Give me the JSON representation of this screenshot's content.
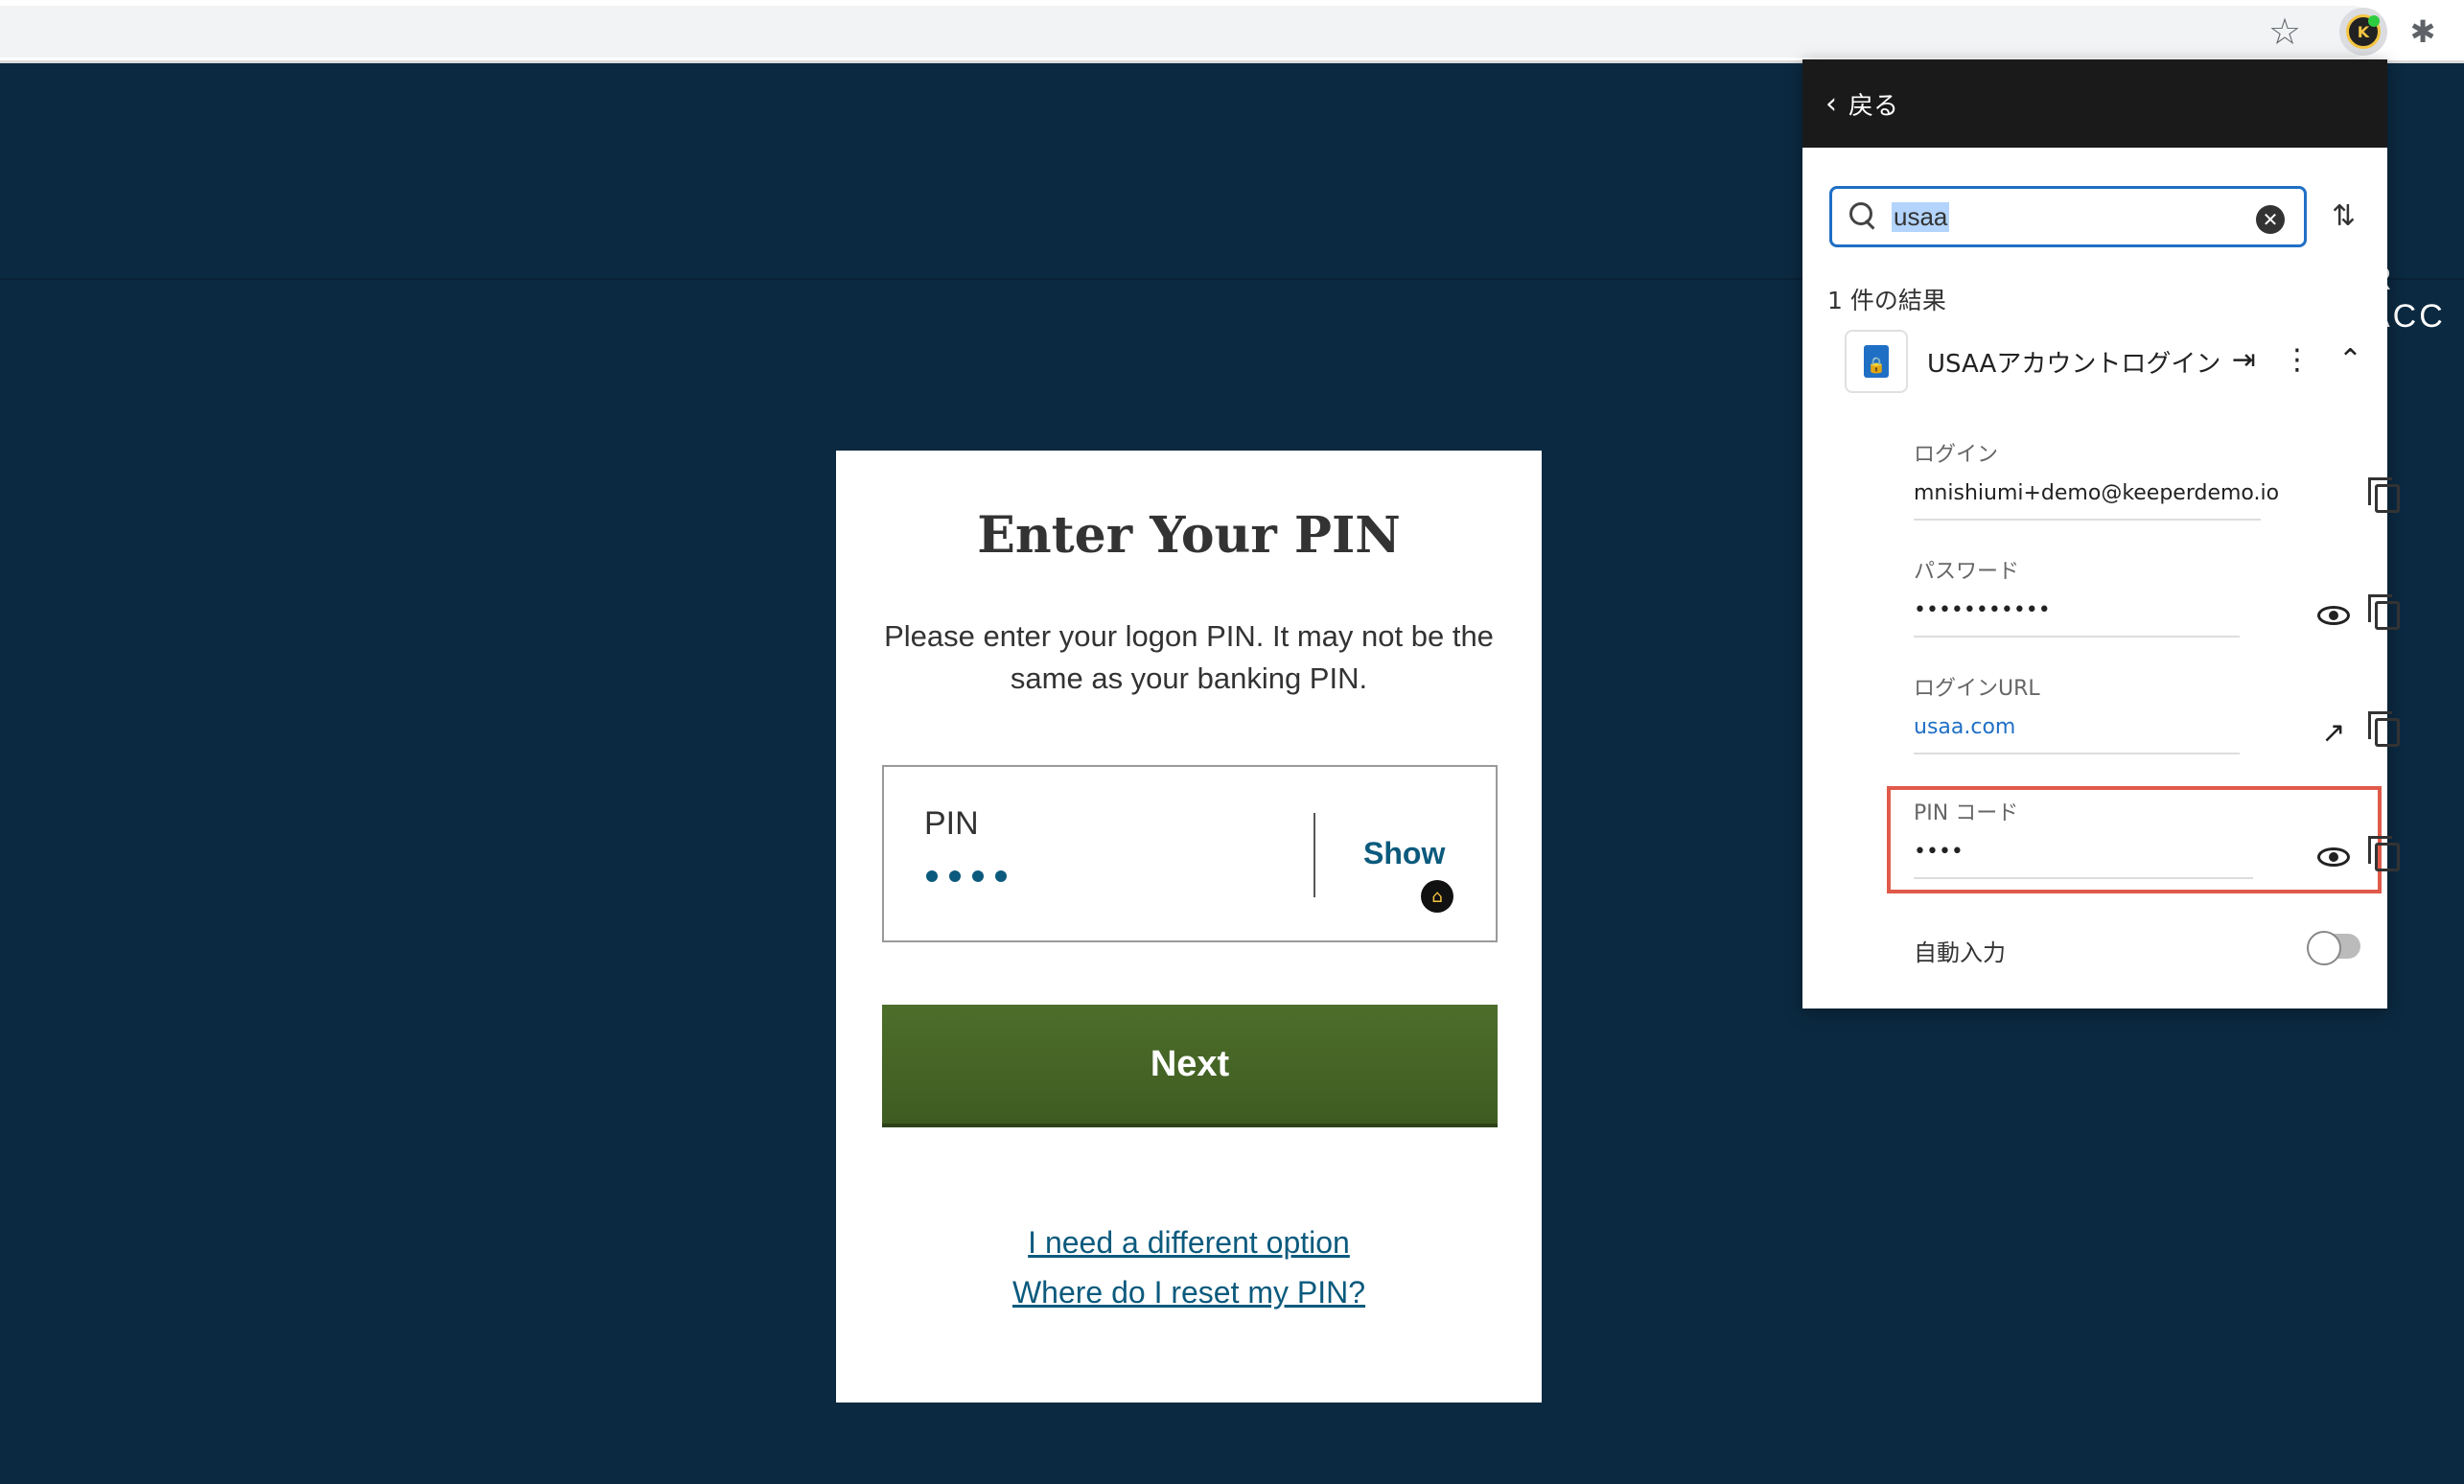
{
  "browser": {
    "extension_names": [
      "star-icon",
      "keeper-extension-icon",
      "puzzle-icon"
    ]
  },
  "page": {
    "nav_text": "R ACC",
    "card": {
      "title": "Enter Your PIN",
      "description": "Please enter your logon PIN. It may not be the same as your banking PIN.",
      "pin_label": "PIN",
      "pin_dots": 4,
      "show_label": "Show",
      "next_label": "Next",
      "links": [
        "I need a different option",
        "Where do I reset my PIN?"
      ]
    }
  },
  "popup": {
    "back_label": "戻る",
    "search_value": "usaa",
    "results_count": "1 件の結果",
    "record_title": "USAAアカウントログイン",
    "fields": {
      "login_label": "ログイン",
      "login_value": "mnishiumi+demo@keeperdemo.io",
      "password_label": "パスワード",
      "password_value": "•••••••••••",
      "url_label": "ログインURL",
      "url_value": "usaa.com",
      "pin_label": "PIN コード",
      "pin_value": "••••"
    },
    "autofill_label": "自動入力",
    "autofill_on": false
  },
  "colors": {
    "page_bg": "#0b2940",
    "next_button": "#496a28",
    "link": "#0b5a7d",
    "keeper_accent": "#1f6fc5",
    "highlight_box": "#e05a4a"
  }
}
